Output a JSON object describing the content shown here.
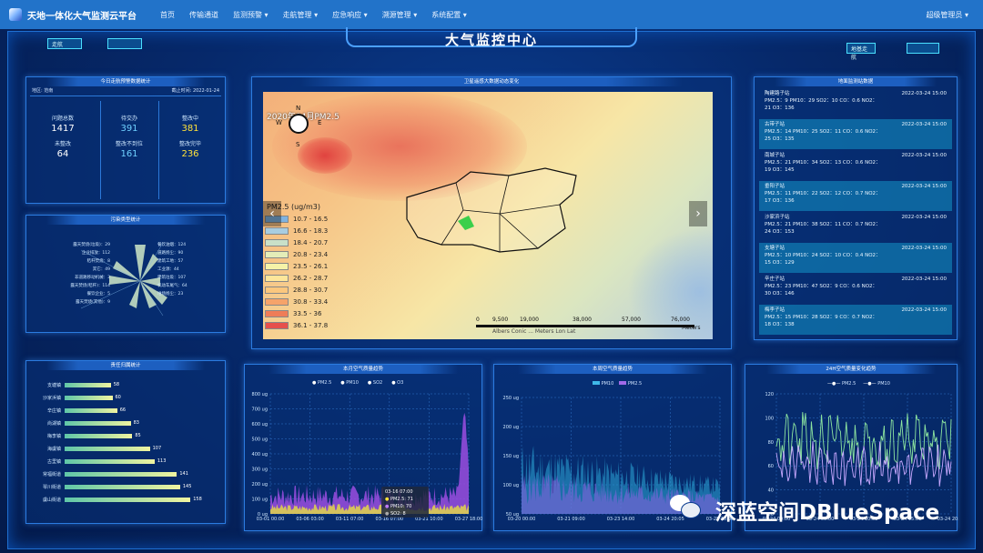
{
  "nav": {
    "brand": "天地一体化大气监测云平台",
    "items": [
      "首页",
      "传输通道",
      "监测预警 ▾",
      "走航管理 ▾",
      "应急响应 ▾",
      "溯源管理 ▾",
      "系统配置 ▾"
    ],
    "user": "超级管理员 ▾"
  },
  "page_title": "大气监控中心",
  "tags": {
    "left": "走航",
    "right": "地基走航"
  },
  "stats_panel": {
    "title": "今日走航预警数据统计",
    "region_label": "地区:",
    "region": "范南",
    "time_label": "截止时间:",
    "time": "2022-01-24",
    "items": [
      {
        "label": "问题总数",
        "value": "1417",
        "color": "#ffffff"
      },
      {
        "label": "待交办",
        "value": "391",
        "color": "#6fd0ff"
      },
      {
        "label": "整改中",
        "value": "381",
        "color": "#ffe23a"
      },
      {
        "label": "未整改",
        "value": "64",
        "color": "#ffffff"
      },
      {
        "label": "整改不到位",
        "value": "161",
        "color": "#6fd0ff"
      },
      {
        "label": "整改完毕",
        "value": "236",
        "color": "#ffe23a"
      }
    ]
  },
  "pollution_panel": {
    "title": "污染类型统计",
    "labels": [
      "餐饮油烟：124",
      "道路扬尘：90",
      "建筑工地：57",
      "工业源：44",
      "建筑垃圾：107",
      "机动车尾气：64",
      "堆场扬尘：23",
      "露天焚烧(垃圾)：29",
      "企业排放：112",
      "秸秆焚烧：8",
      "其它：49",
      "非道路移动机械：3",
      "露天焚烧(秸秆)：114",
      "餐饮企业：5",
      "露天焚烧(其他)：9"
    ]
  },
  "map_panel": {
    "title": "卫星遥感大数据动态变化",
    "overlay": "2020年04月PM2.5",
    "compass": [
      "N",
      "W",
      "E",
      "S"
    ],
    "legend_title": "PM2.5 (ug/m3)",
    "legend": [
      {
        "label": "10.7 - 16.5",
        "color": "#7fb2e0"
      },
      {
        "label": "16.6 - 18.3",
        "color": "#a9cde0"
      },
      {
        "label": "18.4 - 20.7",
        "color": "#c9e0c8"
      },
      {
        "label": "20.8 - 23.4",
        "color": "#e4edb8"
      },
      {
        "label": "23.5 - 26.1",
        "color": "#f6f3a8"
      },
      {
        "label": "26.2 - 28.7",
        "color": "#fde69a"
      },
      {
        "label": "28.8 - 30.7",
        "color": "#fbc77e"
      },
      {
        "label": "30.8 - 33.4",
        "color": "#f6a36a"
      },
      {
        "label": "33.5 - 36",
        "color": "#ef7d58"
      },
      {
        "label": "36.1 - 37.8",
        "color": "#e6504c"
      }
    ],
    "scale": [
      "0",
      "9,500",
      "19,000",
      "38,000",
      "57,000",
      "76,000"
    ],
    "scale_unit": "Meters",
    "credit": "Albers Conic ... Meters Lon Lat"
  },
  "station_panel": {
    "title": "地面监测站数据",
    "stations": [
      {
        "name": "陶建路子站",
        "time": "2022-03-24 15:00",
        "l1": "PM2.5：9 PM10：29 SO2：10 CO：0.6 NO2：",
        "l2": "21 O3：136"
      },
      {
        "name": "古带子站",
        "time": "2022-03-24 15:00",
        "l1": "PM2.5：14 PM10：25 SO2：11 CO：0.6 NO2：",
        "l2": "25 O3：135"
      },
      {
        "name": "南城子站",
        "time": "2022-03-24 15:00",
        "l1": "PM2.5：21 PM10：34 SO2：13 CO：0.6 NO2：",
        "l2": "19 O3：145"
      },
      {
        "name": "垂阳子站",
        "time": "2022-03-24 15:00",
        "l1": "PM2.5：11 PM10：22 SO2：12 CO：0.7 NO2：",
        "l2": "17 O3：136"
      },
      {
        "name": "沙家浜子站",
        "time": "2022-03-24 15:00",
        "l1": "PM2.5：21 PM10：38 SO2：11 CO：0.7 NO2：",
        "l2": "24 O3：153"
      },
      {
        "name": "支塘子站",
        "time": "2022-03-24 15:00",
        "l1": "PM2.5：10 PM10：24 SO2：10 CO：0.4 NO2：",
        "l2": "15 O3：129"
      },
      {
        "name": "辛庄子站",
        "time": "2022-03-24 15:00",
        "l1": "PM2.5：23 PM10：47 SO2：9 CO：0.6 NO2：",
        "l2": "30 O3：146"
      },
      {
        "name": "梅李子站",
        "time": "2022-03-24 15:00",
        "l1": "PM2.5：15 PM10：28 SO2：9 CO：0.7 NO2：",
        "l2": "18 O3：138"
      }
    ]
  },
  "rank_panel": {
    "title": "责任归属统计",
    "rows": [
      {
        "name": "支塘镇",
        "value": 58
      },
      {
        "name": "沙家浜镇",
        "value": 60
      },
      {
        "name": "辛庄镇",
        "value": 66
      },
      {
        "name": "尚湖镇",
        "value": 83
      },
      {
        "name": "梅李镇",
        "value": 85
      },
      {
        "name": "海虞镇",
        "value": 107
      },
      {
        "name": "古里镇",
        "value": 113
      },
      {
        "name": "常福街道",
        "value": 141
      },
      {
        "name": "琴川街道",
        "value": 145
      },
      {
        "name": "虞山街道",
        "value": 158
      }
    ]
  },
  "month_chart": {
    "title": "本月空气质量趋势",
    "legend": [
      "PM2.5",
      "PM10",
      "SO2",
      "O3"
    ],
    "yticks": [
      "800 ug",
      "700 ug",
      "600 ug",
      "500 ug",
      "400 ug",
      "300 ug",
      "200 ug",
      "100 ug",
      "0 ug"
    ],
    "xticks": [
      "03-01 00:00",
      "03-06 03:00",
      "03-11 07:00",
      "03-16 07:00",
      "03-21 10:00",
      "03-27 18:00"
    ],
    "tooltip": {
      "time": "03-16 07:00",
      "rows": [
        "PM2.5: 71",
        "PM10: 70",
        "SO2: 8"
      ]
    }
  },
  "week_chart": {
    "title": "本周空气质量趋势",
    "legend": [
      "PM10",
      "PM2.5"
    ],
    "yticks": [
      "250 ug",
      "200 ug",
      "150 ug",
      "100 ug",
      "50 ug"
    ],
    "xticks": [
      "03-20 00:00",
      "03-21 09:00",
      "03-23 14:00",
      "03-24 20:05",
      "03-25 10:00"
    ]
  },
  "day_chart": {
    "title": "24H空气质量变化趋势",
    "legend": [
      "PM2.5",
      "PM10"
    ],
    "yticks": [
      "120",
      "100",
      "80",
      "60",
      "40",
      "20"
    ],
    "xticks": [
      "03-24 00:00",
      "03-24 05:00",
      "03-24 10:00",
      "03-24 15:00",
      "03-24 20:00"
    ]
  },
  "watermark": "深蓝空间DBlueSpace",
  "chart_data": [
    {
      "type": "bar",
      "title": "责任归属统计",
      "categories": [
        "支塘镇",
        "沙家浜镇",
        "辛庄镇",
        "尚湖镇",
        "梅李镇",
        "海虞镇",
        "古里镇",
        "常福街道",
        "琴川街道",
        "虞山街道"
      ],
      "values": [
        58,
        60,
        66,
        83,
        85,
        107,
        113,
        141,
        145,
        158
      ]
    },
    {
      "type": "area",
      "title": "本月空气质量趋势",
      "series": [
        {
          "name": "PM2.5"
        },
        {
          "name": "PM10"
        },
        {
          "name": "SO2"
        },
        {
          "name": "O3"
        }
      ],
      "ylim": [
        0,
        800
      ]
    },
    {
      "type": "area",
      "title": "本周空气质量趋势",
      "series": [
        {
          "name": "PM10"
        },
        {
          "name": "PM2.5"
        }
      ],
      "ylim": [
        0,
        250
      ]
    },
    {
      "type": "line",
      "title": "24H空气质量变化趋势",
      "series": [
        {
          "name": "PM2.5"
        },
        {
          "name": "PM10"
        }
      ],
      "ylim": [
        0,
        120
      ]
    }
  ]
}
